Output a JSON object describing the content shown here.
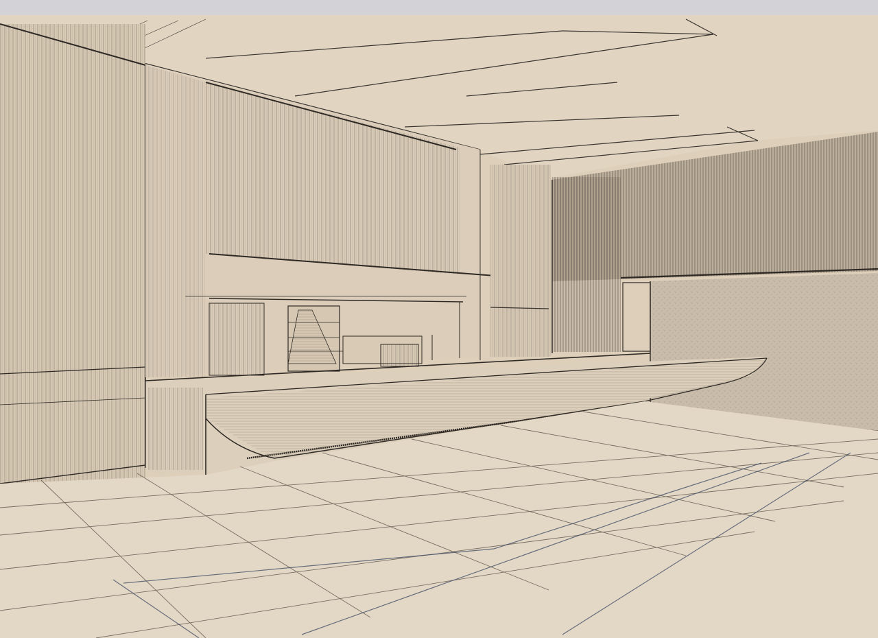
{
  "image": {
    "subject": "interior-perspective-sketch",
    "medium": "pencil-on-paper",
    "colors": {
      "frame": "#d3d2d6",
      "paper": "#ddcfba",
      "ink": "#3a3530",
      "ink_light": "#6b6258",
      "blue_ink": "#3d4a63",
      "texture_wall": "#b9aea0"
    }
  }
}
